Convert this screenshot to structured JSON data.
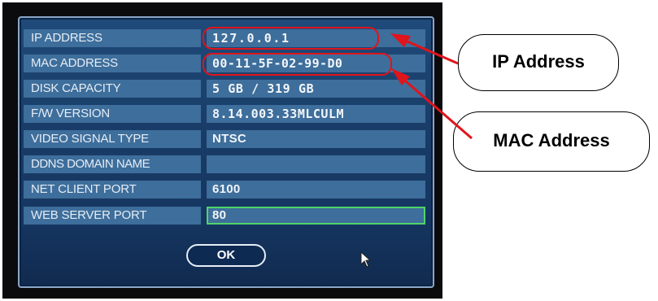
{
  "rows": [
    {
      "label": "IP ADDRESS",
      "value": "127.0.0.1"
    },
    {
      "label": "MAC ADDRESS",
      "value": "00-11-5F-02-99-D0"
    },
    {
      "label": "DISK CAPACITY",
      "value": "5 GB / 319 GB"
    },
    {
      "label": "F/W VERSION",
      "value": "8.14.003.33MLCULM"
    },
    {
      "label": "VIDEO SIGNAL TYPE",
      "value": "NTSC"
    },
    {
      "label": "DDNS DOMAIN NAME",
      "value": ""
    },
    {
      "label": "NET CLIENT PORT",
      "value": "6100"
    },
    {
      "label": "WEB SERVER PORT",
      "value": "80"
    }
  ],
  "ok_label": "OK",
  "callouts": {
    "ip": "IP Address",
    "mac": "MAC Address"
  },
  "colors": {
    "highlight": "#e0141b",
    "selection": "#4fd56a",
    "field": "#3e6e9b"
  },
  "icons": [
    "mouse-pointer-icon",
    "arrow-icon"
  ]
}
